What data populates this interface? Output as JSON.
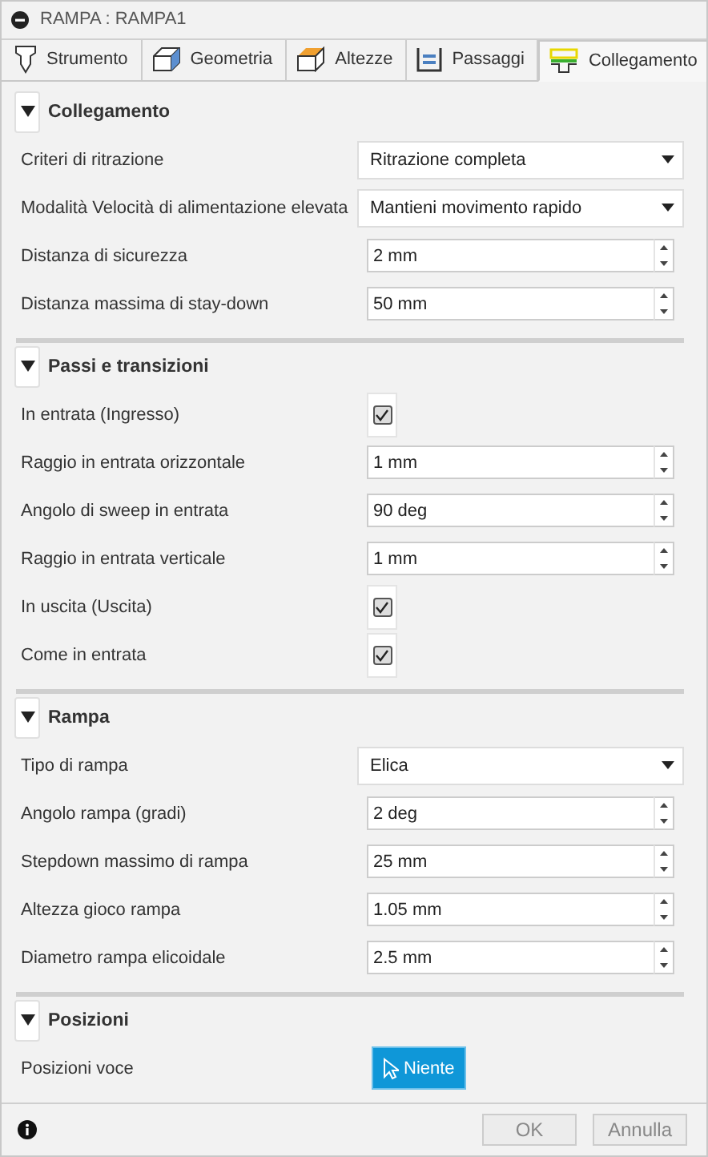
{
  "window": {
    "title": "RAMPA : RAMPA1"
  },
  "tabs": [
    {
      "label": "Strumento",
      "selected": false
    },
    {
      "label": "Geometria",
      "selected": false
    },
    {
      "label": "Altezze",
      "selected": false
    },
    {
      "label": "Passaggi",
      "selected": false
    },
    {
      "label": "Collegamento",
      "selected": true
    }
  ],
  "sections": [
    {
      "title": "Collegamento",
      "expanded": true,
      "rows": [
        {
          "kind": "dropdown",
          "label": "Criteri di ritrazione",
          "value": "Ritrazione completa"
        },
        {
          "kind": "dropdown",
          "label": "Modalità Velocità di alimentazione elevata",
          "value": "Mantieni movimento rapido"
        },
        {
          "kind": "spinner",
          "label": "Distanza di sicurezza",
          "value": "2 mm"
        },
        {
          "kind": "spinner",
          "label": "Distanza massima di stay-down",
          "value": "50 mm"
        }
      ]
    },
    {
      "title": "Passi e transizioni",
      "expanded": true,
      "rows": [
        {
          "kind": "checkbox",
          "label": "In entrata (Ingresso)",
          "checked": true
        },
        {
          "kind": "spinner",
          "label": "Raggio in entrata orizzontale",
          "value": "1 mm"
        },
        {
          "kind": "spinner",
          "label": "Angolo di sweep in entrata",
          "value": "90 deg"
        },
        {
          "kind": "spinner",
          "label": "Raggio in entrata verticale",
          "value": "1 mm"
        },
        {
          "kind": "checkbox",
          "label": "In uscita (Uscita)",
          "checked": true
        },
        {
          "kind": "checkbox",
          "label": "Come in entrata",
          "checked": true
        }
      ]
    },
    {
      "title": "Rampa",
      "expanded": true,
      "rows": [
        {
          "kind": "dropdown",
          "label": "Tipo di rampa",
          "value": "Elica"
        },
        {
          "kind": "spinner",
          "label": "Angolo rampa (gradi)",
          "value": "2 deg"
        },
        {
          "kind": "spinner",
          "label": "Stepdown massimo di rampa",
          "value": "25 mm"
        },
        {
          "kind": "spinner",
          "label": "Altezza gioco rampa",
          "value": "1.05 mm"
        },
        {
          "kind": "spinner",
          "label": "Diametro rampa elicoidale",
          "value": "2.5 mm"
        }
      ]
    },
    {
      "title": "Posizioni",
      "expanded": true,
      "rows": [
        {
          "kind": "select-button",
          "label": "Posizioni voce",
          "value": "Niente"
        }
      ]
    }
  ],
  "footer": {
    "buttons": [
      "OK",
      "Annulla"
    ]
  }
}
